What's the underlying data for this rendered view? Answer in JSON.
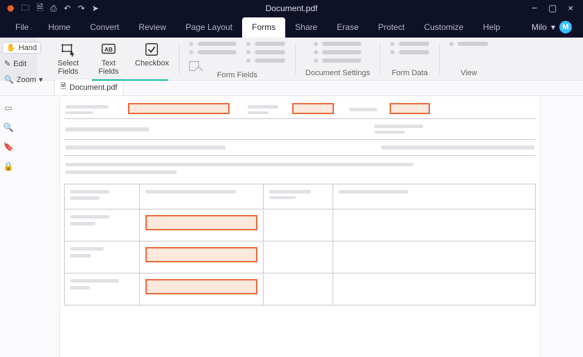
{
  "title_bar": {
    "document_name": "Document.pdf",
    "icons": {
      "app": "app-logo",
      "open": "folder-open",
      "save": "save",
      "print": "printer",
      "undo": "undo",
      "redo": "redo",
      "cursor": "cursor"
    },
    "window": {
      "min": "−",
      "max": "▢",
      "close": "×"
    }
  },
  "menubar": {
    "items": [
      "File",
      "Home",
      "Convert",
      "Review",
      "Page Layout",
      "Forms",
      "Share",
      "Erase",
      "Protect",
      "Customize",
      "Help"
    ],
    "active_index": 5,
    "user_name": "Milo"
  },
  "left_tools": {
    "items": [
      {
        "label": "Hand",
        "icon": "hand"
      },
      {
        "label": "Edit",
        "icon": "edit"
      },
      {
        "label": "Zoom",
        "icon": "zoom",
        "has_dropdown": true
      }
    ]
  },
  "ribbon": {
    "tools_group": {
      "buttons": [
        {
          "label": "Select Fields",
          "icon": "select-fields"
        },
        {
          "label": "Text Fields",
          "icon": "text-fields"
        },
        {
          "label": "Checkbox",
          "icon": "checkbox"
        }
      ]
    },
    "groups": [
      {
        "label": "Form Fields"
      },
      {
        "label": "Document Settings"
      },
      {
        "label": "Form Data"
      },
      {
        "label": "View"
      }
    ]
  },
  "tab_strip": {
    "tabs": [
      {
        "label": "Document.pdf"
      }
    ]
  },
  "side_rail": {
    "items": [
      "pages-panel",
      "search",
      "bookmark",
      "lock"
    ]
  },
  "accent_color": "#e86a3a",
  "teal_color": "#1bbda1"
}
